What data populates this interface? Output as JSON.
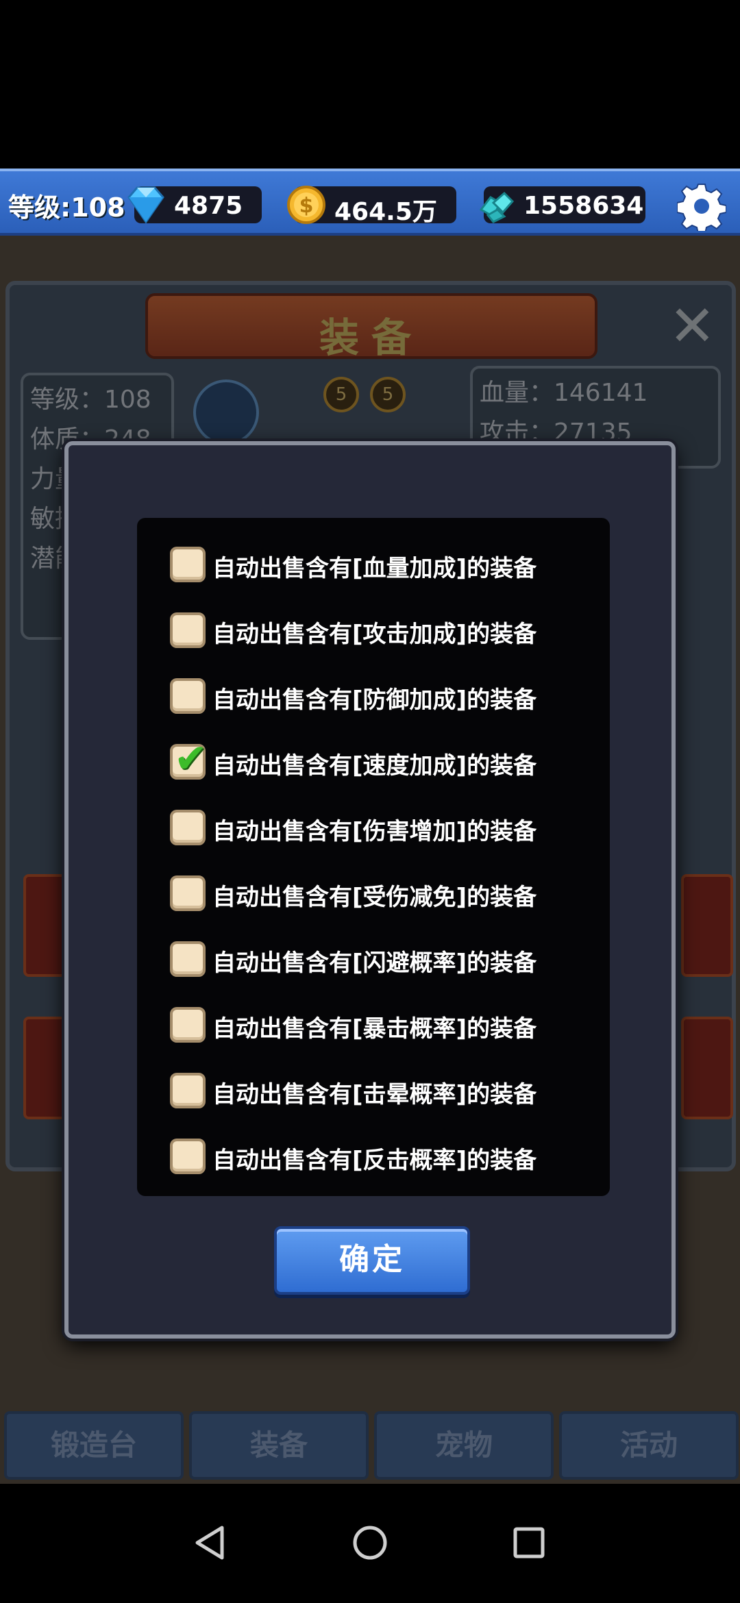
{
  "topbar": {
    "level": "等级:108",
    "diamonds": "4875",
    "gold": "464.5万",
    "gems": "1558634",
    "colors": {
      "bar": "#3f79d6",
      "diamond": "#4fc3ff",
      "gold": "#f5b82e",
      "gem": "#3fd1d6"
    }
  },
  "background": {
    "title": "装备",
    "stats_left": [
      "等级：108",
      "体质：248",
      "力量",
      "敏捷",
      "潜能"
    ],
    "stats_right": [
      "血量：146141",
      "攻击：27135"
    ],
    "badges": [
      "5",
      "5"
    ],
    "tabs": [
      "锻造台",
      "装备",
      "宠物",
      "活动"
    ]
  },
  "modal": {
    "options": [
      {
        "label": "自动出售含有[血量加成]的装备",
        "checked": false
      },
      {
        "label": "自动出售含有[攻击加成]的装备",
        "checked": false
      },
      {
        "label": "自动出售含有[防御加成]的装备",
        "checked": false
      },
      {
        "label": "自动出售含有[速度加成]的装备",
        "checked": true
      },
      {
        "label": "自动出售含有[伤害增加]的装备",
        "checked": false
      },
      {
        "label": "自动出售含有[受伤减免]的装备",
        "checked": false
      },
      {
        "label": "自动出售含有[闪避概率]的装备",
        "checked": false
      },
      {
        "label": "自动出售含有[暴击概率]的装备",
        "checked": false
      },
      {
        "label": "自动出售含有[击晕概率]的装备",
        "checked": false
      },
      {
        "label": "自动出售含有[反击概率]的装备",
        "checked": false
      }
    ],
    "confirm_label": "确定",
    "check_mark": "✔"
  }
}
